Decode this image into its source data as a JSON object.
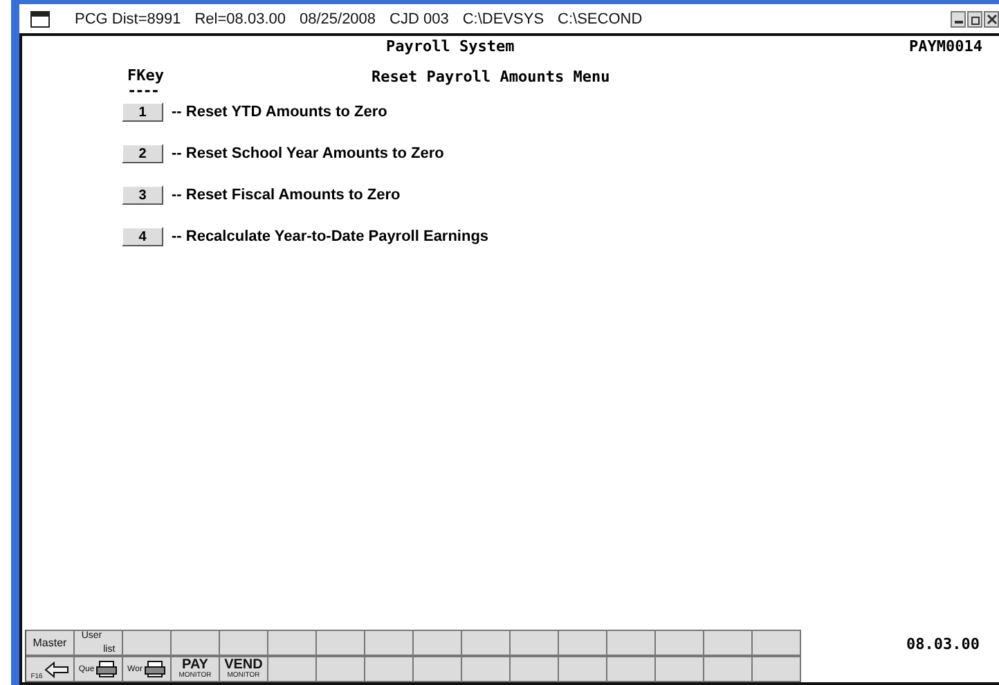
{
  "window": {
    "title_parts": [
      "PCG Dist=8991",
      "Rel=08.03.00",
      "08/25/2008",
      "CJD 003",
      "C:\\DEVSYS",
      "C:\\SECOND"
    ]
  },
  "header": {
    "system": "Payroll System",
    "screen_id": "PAYM0014",
    "fkey_label": "FKey",
    "fkey_rule": "----",
    "menu_title": "Reset Payroll Amounts Menu"
  },
  "menu": [
    {
      "key": "1",
      "label": "-- Reset YTD Amounts to Zero"
    },
    {
      "key": "2",
      "label": "-- Reset School Year Amounts to Zero"
    },
    {
      "key": "3",
      "label": "-- Reset Fiscal Amounts to Zero"
    },
    {
      "key": "4",
      "label": "-- Recalculate Year-to-Date Payroll Earnings"
    }
  ],
  "toolbar": {
    "row_1": [
      {
        "kind": "text",
        "text": "Master"
      },
      {
        "kind": "sub",
        "text": "User",
        "sub": "list"
      },
      {
        "kind": "empty"
      },
      {
        "kind": "empty"
      },
      {
        "kind": "empty"
      },
      {
        "kind": "empty"
      },
      {
        "kind": "empty"
      },
      {
        "kind": "empty"
      },
      {
        "kind": "empty"
      },
      {
        "kind": "empty"
      },
      {
        "kind": "empty"
      },
      {
        "kind": "empty"
      },
      {
        "kind": "empty"
      },
      {
        "kind": "empty"
      },
      {
        "kind": "empty"
      },
      {
        "kind": "empty"
      }
    ],
    "row_2": [
      {
        "kind": "back",
        "text": "F16"
      },
      {
        "kind": "printer",
        "text": "Que"
      },
      {
        "kind": "printer",
        "text": "Wor"
      },
      {
        "kind": "monitor",
        "text": "PAY",
        "sub": "MONITOR"
      },
      {
        "kind": "monitor",
        "text": "VEND",
        "sub": "MONITOR"
      },
      {
        "kind": "empty"
      },
      {
        "kind": "empty"
      },
      {
        "kind": "empty"
      },
      {
        "kind": "empty"
      },
      {
        "kind": "empty"
      },
      {
        "kind": "empty"
      },
      {
        "kind": "empty"
      },
      {
        "kind": "empty"
      },
      {
        "kind": "empty"
      },
      {
        "kind": "empty"
      },
      {
        "kind": "empty"
      }
    ]
  },
  "version": "08.03.00"
}
